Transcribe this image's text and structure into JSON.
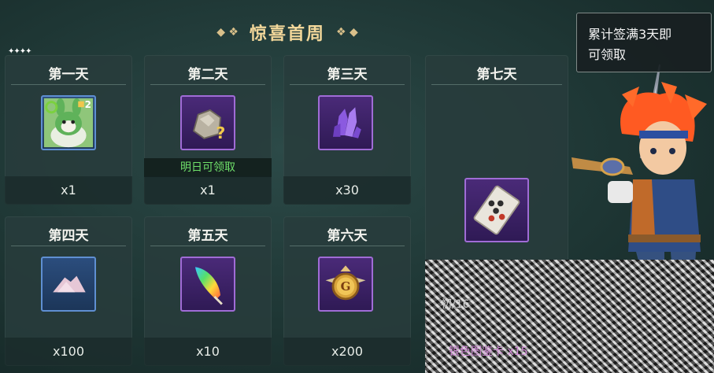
{
  "header": {
    "title": "惊喜首周"
  },
  "tooltip": {
    "text_line1": "累计签满3天即",
    "text_line2": "可领取"
  },
  "days": [
    {
      "label": "第一天",
      "qty": "x1",
      "icon": "rabbit-pet-icon",
      "badge": "2"
    },
    {
      "label": "第二天",
      "qty": "x1",
      "icon": "mystery-ore-icon",
      "claim": "明日可领取"
    },
    {
      "label": "第三天",
      "qty": "x30",
      "icon": "purple-crystal-icon"
    },
    {
      "label": "第四天",
      "qty": "x100",
      "icon": "pink-powder-icon"
    },
    {
      "label": "第五天",
      "qty": "x10",
      "icon": "rainbow-feather-icon"
    },
    {
      "label": "第六天",
      "qty": "x200",
      "icon": "gold-medal-icon",
      "medal_letter": "G"
    },
    {
      "label": "第七天",
      "icon": "rune-card-icon"
    }
  ],
  "obscured": {
    "label1": "初/16",
    "label2": "银色图鉴卡 x15"
  },
  "colors": {
    "accent_gold": "#f2d79a",
    "claim_green": "#6fe06a",
    "rare_purple": "#a06cd6",
    "common_blue": "#5f8fd2"
  }
}
